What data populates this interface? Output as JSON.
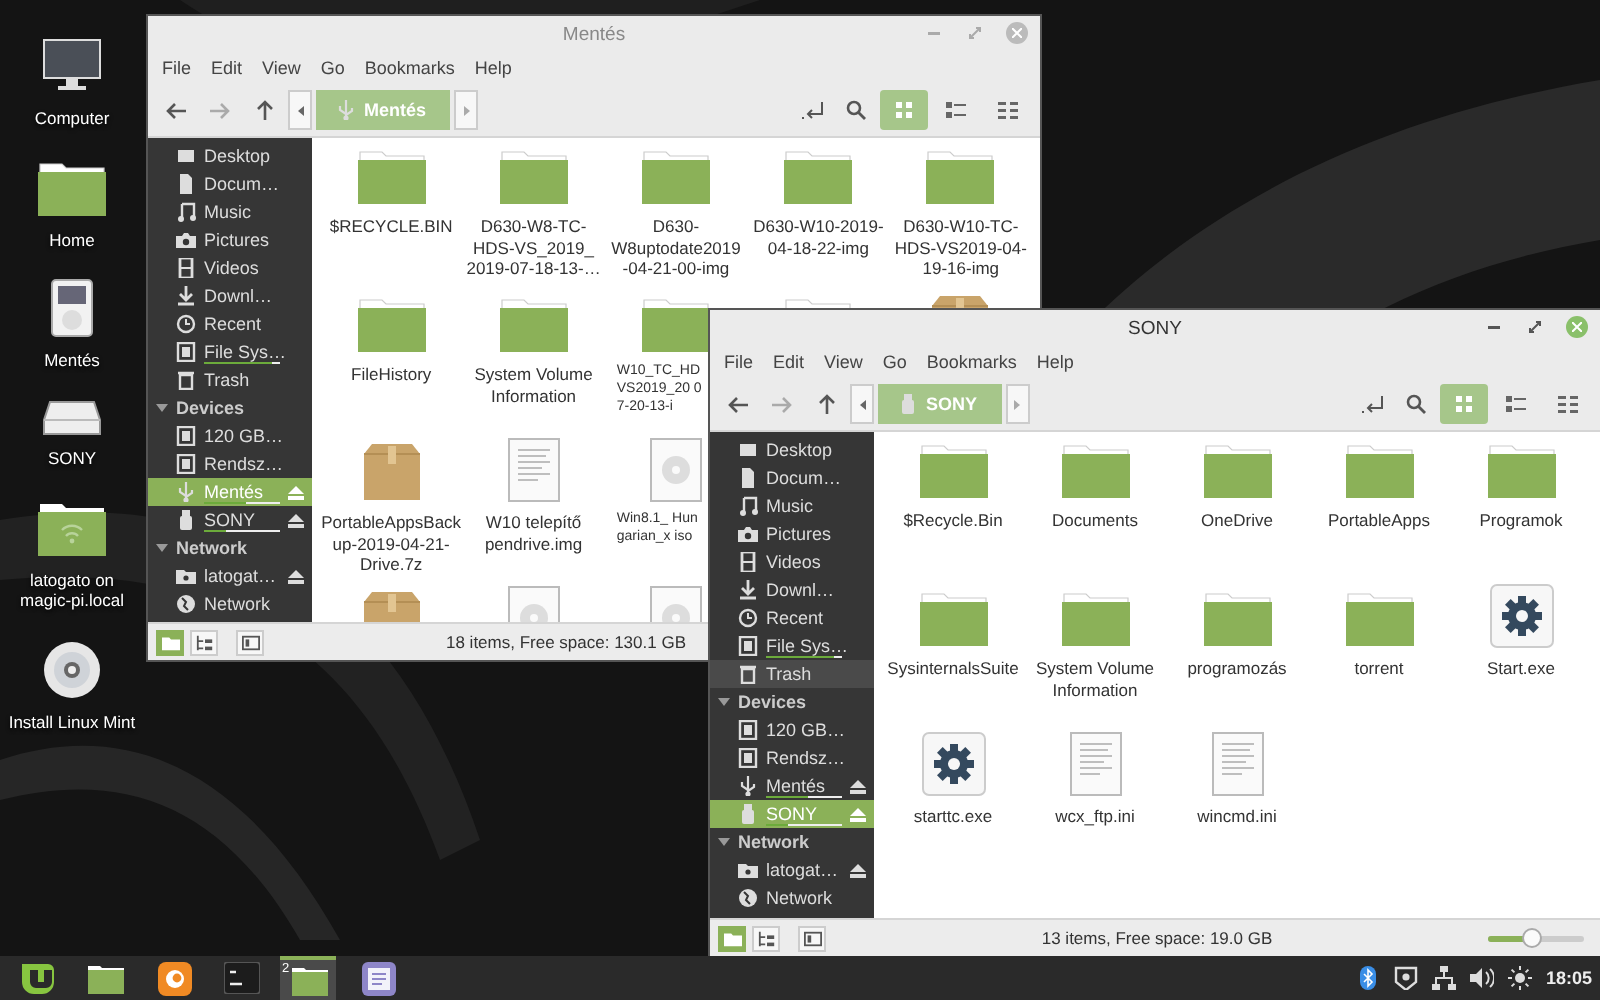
{
  "desktop_icons": [
    {
      "kind": "computer",
      "label": "Computer"
    },
    {
      "kind": "home",
      "label": "Home"
    },
    {
      "kind": "player",
      "label": "Mentés"
    },
    {
      "kind": "drive",
      "label": "SONY"
    },
    {
      "kind": "network-folder",
      "label": "latogato on magic-pi.local"
    },
    {
      "kind": "disc",
      "label": "Install Linux Mint"
    }
  ],
  "windows": [
    {
      "title": "Mentés",
      "active": false,
      "menu": [
        "File",
        "Edit",
        "View",
        "Go",
        "Bookmarks",
        "Help"
      ],
      "path": {
        "label": "Mentés",
        "kind": "usb"
      },
      "view_modes": [
        {
          "kind": "grid",
          "selected": true
        },
        {
          "kind": "list",
          "selected": false
        },
        {
          "kind": "compact",
          "selected": false
        }
      ],
      "sidebar": [
        {
          "kind": "desktop",
          "label": "Desktop",
          "selected": false
        },
        {
          "kind": "document",
          "label": "Docum…",
          "selected": false
        },
        {
          "kind": "music",
          "label": "Music",
          "selected": false
        },
        {
          "kind": "camera",
          "label": "Pictures",
          "selected": false
        },
        {
          "kind": "film",
          "label": "Videos",
          "selected": false
        },
        {
          "kind": "download",
          "label": "Downl…",
          "selected": false
        },
        {
          "kind": "clock",
          "label": "Recent",
          "selected": false
        },
        {
          "kind": "drive",
          "label": "File Sys…",
          "selected": false,
          "level": 0.9
        },
        {
          "kind": "trash",
          "label": "Trash",
          "selected": false
        },
        {
          "kind": "header",
          "label": "Devices",
          "expanded": true
        },
        {
          "kind": "drive",
          "label": "120 GB…",
          "selected": false
        },
        {
          "kind": "drive",
          "label": "Rendsz…",
          "selected": false
        },
        {
          "kind": "usb",
          "label": "Mentés",
          "selected": true,
          "eject": true,
          "level": 0.55
        },
        {
          "kind": "stick",
          "label": "SONY",
          "selected": false,
          "eject": true,
          "level": 0.3
        },
        {
          "kind": "header",
          "label": "Network",
          "expanded": true
        },
        {
          "kind": "share",
          "label": "latogat…",
          "selected": false,
          "eject": true
        },
        {
          "kind": "globe",
          "label": "Network",
          "selected": false
        }
      ],
      "files": [
        {
          "kind": "folder",
          "label": "$RECYCLE.BIN"
        },
        {
          "kind": "folder",
          "label": "D630-W8-TC-HDS-VS_2019_ 2019-07-18-13-…"
        },
        {
          "kind": "folder",
          "label": "D630-W8uptodate2019 -04-21-00-img"
        },
        {
          "kind": "folder",
          "label": "D630-W10-2019-04-18-22-img"
        },
        {
          "kind": "folder",
          "label": "D630-W10-TC-HDS-VS2019-04-19-16-img"
        },
        {
          "kind": "folder",
          "label": "FileHistory"
        },
        {
          "kind": "folder",
          "label": "System Volume Information"
        },
        {
          "kind": "folder",
          "label": "W10_TC_HD VS2019_20 07-20-13-i",
          "clipped": true
        },
        {
          "kind": "folder"
        },
        {
          "kind": "archive"
        },
        {
          "kind": "archive",
          "label": "PortableAppsBackup-2019-04-21-Drive.7z"
        },
        {
          "kind": "text",
          "label": "W10 telepítő pendrive.img"
        },
        {
          "kind": "disc",
          "label": "Win8.1_ Hungarian_x iso",
          "clipped": true
        },
        {
          "kind": "none"
        },
        {
          "kind": "none"
        },
        {
          "kind": "archive"
        },
        {
          "kind": "disc"
        },
        {
          "kind": "disc"
        }
      ],
      "status_buttons": [
        {
          "kind": "places",
          "selected": true
        },
        {
          "kind": "tree",
          "selected": false
        },
        {
          "kind": "toggle",
          "selected": false
        }
      ],
      "status": "18 items, Free space: 130.1 GB"
    },
    {
      "title": "SONY",
      "active": true,
      "menu": [
        "File",
        "Edit",
        "View",
        "Go",
        "Bookmarks",
        "Help"
      ],
      "path": {
        "label": "SONY",
        "kind": "stick"
      },
      "view_modes": [
        {
          "kind": "grid",
          "selected": true
        },
        {
          "kind": "list",
          "selected": false
        },
        {
          "kind": "compact",
          "selected": false
        }
      ],
      "sidebar": [
        {
          "kind": "desktop",
          "label": "Desktop",
          "selected": false
        },
        {
          "kind": "document",
          "label": "Docum…",
          "selected": false
        },
        {
          "kind": "music",
          "label": "Music",
          "selected": false
        },
        {
          "kind": "camera",
          "label": "Pictures",
          "selected": false
        },
        {
          "kind": "film",
          "label": "Videos",
          "selected": false
        },
        {
          "kind": "download",
          "label": "Downl…",
          "selected": false
        },
        {
          "kind": "clock",
          "label": "Recent",
          "selected": false
        },
        {
          "kind": "drive",
          "label": "File Sys…",
          "selected": false,
          "level": 0.9
        },
        {
          "kind": "trash",
          "label": "Trash",
          "selected": false,
          "hovered": true
        },
        {
          "kind": "header",
          "label": "Devices",
          "expanded": true
        },
        {
          "kind": "drive",
          "label": "120 GB…",
          "selected": false
        },
        {
          "kind": "drive",
          "label": "Rendsz…",
          "selected": false
        },
        {
          "kind": "usb",
          "label": "Mentés",
          "selected": false,
          "eject": true,
          "level": 0.55
        },
        {
          "kind": "stick",
          "label": "SONY",
          "selected": true,
          "eject": true,
          "level": 0.3
        },
        {
          "kind": "header",
          "label": "Network",
          "expanded": true
        },
        {
          "kind": "share",
          "label": "latogat…",
          "selected": false,
          "eject": true
        },
        {
          "kind": "globe",
          "label": "Network",
          "selected": false
        }
      ],
      "files": [
        {
          "kind": "folder",
          "label": "$Recycle.Bin"
        },
        {
          "kind": "folder",
          "label": "Documents"
        },
        {
          "kind": "folder",
          "label": "OneDrive"
        },
        {
          "kind": "folder",
          "label": "PortableApps"
        },
        {
          "kind": "folder",
          "label": "Programok"
        },
        {
          "kind": "folder",
          "label": "SysinternalsSuite"
        },
        {
          "kind": "folder",
          "label": "System Volume Information"
        },
        {
          "kind": "folder",
          "label": "programozás"
        },
        {
          "kind": "folder",
          "label": "torrent"
        },
        {
          "kind": "executable",
          "label": "Start.exe"
        },
        {
          "kind": "executable",
          "label": "starttc.exe"
        },
        {
          "kind": "text",
          "label": "wcx_ftp.ini"
        },
        {
          "kind": "text",
          "label": "wincmd.ini"
        }
      ],
      "status_buttons": [
        {
          "kind": "places",
          "selected": true
        },
        {
          "kind": "tree",
          "selected": false
        },
        {
          "kind": "toggle",
          "selected": false
        }
      ],
      "status": "13 items, Free space: 19.0 GB",
      "zoom": {
        "level": 0.45
      }
    }
  ],
  "taskbar": {
    "items": [
      {
        "kind": "menu",
        "active": false
      },
      {
        "kind": "files",
        "active": false
      },
      {
        "kind": "browser",
        "active": false
      },
      {
        "kind": "terminal",
        "active": false
      },
      {
        "kind": "files",
        "active": true,
        "badge": "2"
      },
      {
        "kind": "notes",
        "active": false
      }
    ],
    "tray": [
      {
        "kind": "bluetooth"
      },
      {
        "kind": "update"
      },
      {
        "kind": "network"
      },
      {
        "kind": "volume"
      },
      {
        "kind": "brightness"
      }
    ],
    "clock": "18:05"
  }
}
